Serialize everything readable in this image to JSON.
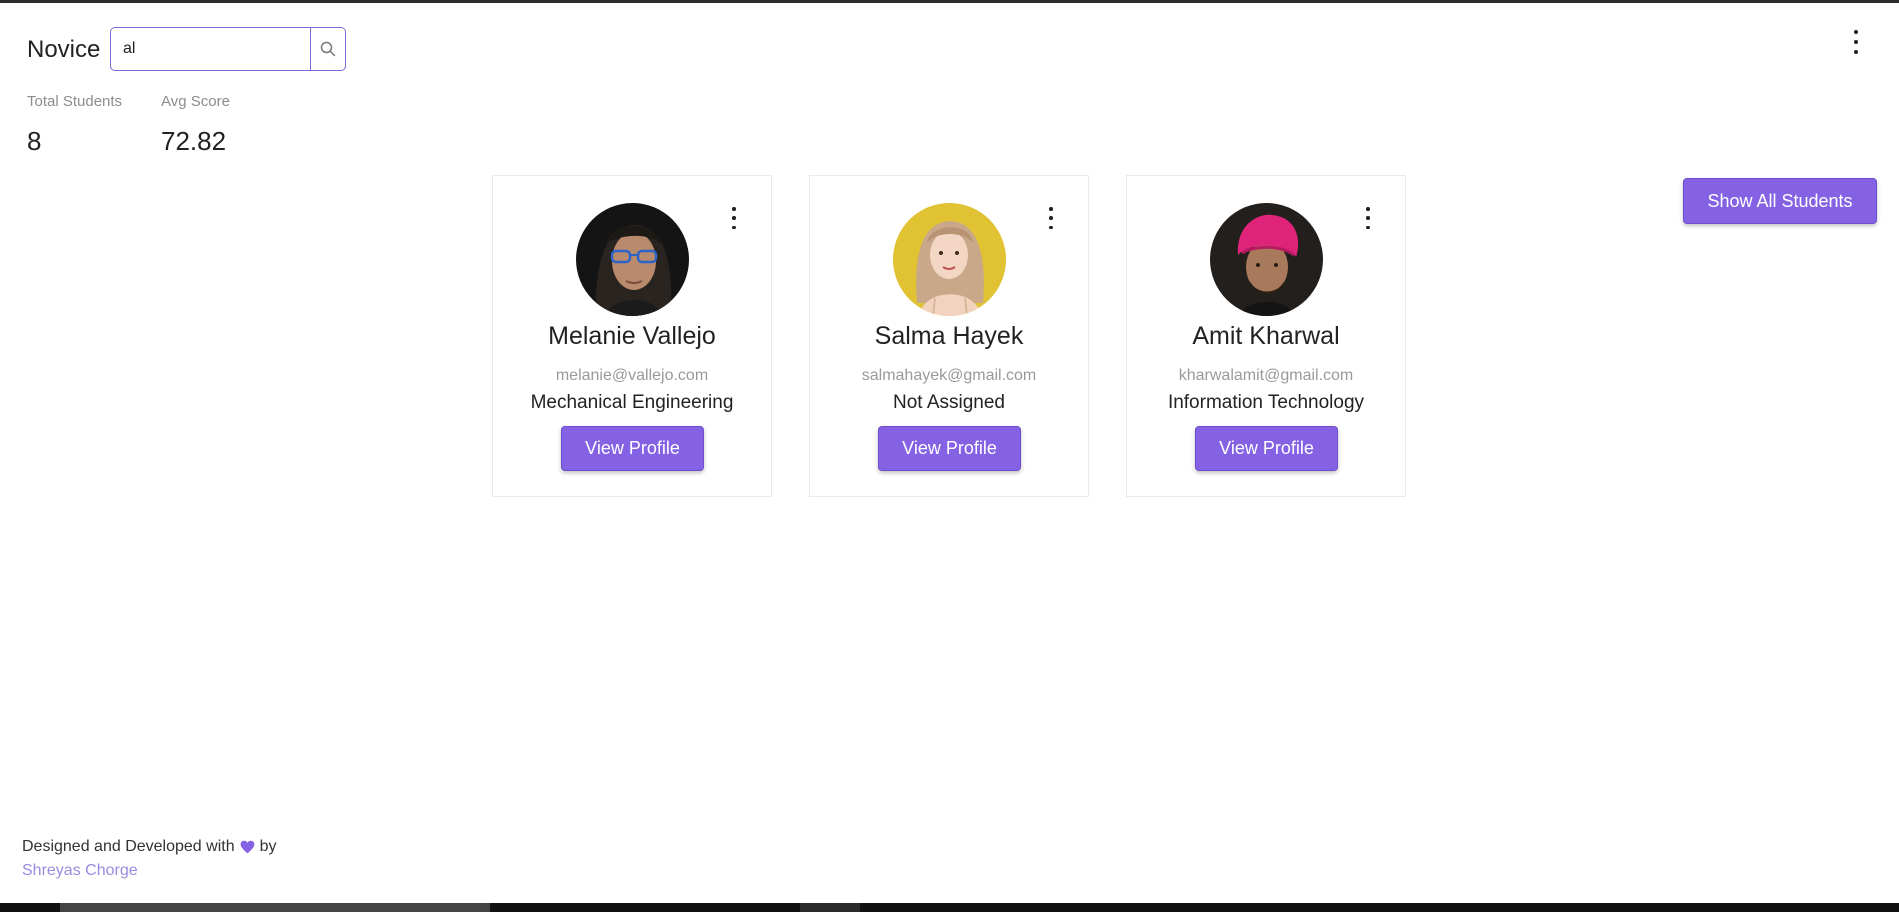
{
  "header": {
    "brand": "Novice",
    "search": {
      "value": "al",
      "placeholder": ""
    },
    "icons": {
      "search": "search-icon",
      "menu": "more-vertical-icon"
    }
  },
  "stats": [
    {
      "label": "Total Students",
      "value": "8"
    },
    {
      "label": "Avg Score",
      "value": "72.82"
    }
  ],
  "actions": {
    "show_all_label": "Show All Students"
  },
  "students": [
    {
      "name": "Melanie Vallejo",
      "email": "melanie@vallejo.com",
      "department": "Mechanical Engineering",
      "button": "View Profile",
      "avatar_icon": "avatar-photo"
    },
    {
      "name": "Salma Hayek",
      "email": "salmahayek@gmail.com",
      "department": "Not Assigned",
      "button": "View Profile",
      "avatar_icon": "avatar-photo"
    },
    {
      "name": "Amit Kharwal",
      "email": "kharwalamit@gmail.com",
      "department": "Information Technology",
      "button": "View Profile",
      "avatar_icon": "avatar-photo"
    }
  ],
  "footer": {
    "text_before": "Designed and Developed with",
    "text_after": "by",
    "author": "Shreyas Chorge",
    "heart_icon": "heart-icon"
  },
  "colors": {
    "accent": "#8462e3",
    "accent_border": "#6e4fd0",
    "muted": "#9a9a9a",
    "link": "#9a8be0"
  }
}
